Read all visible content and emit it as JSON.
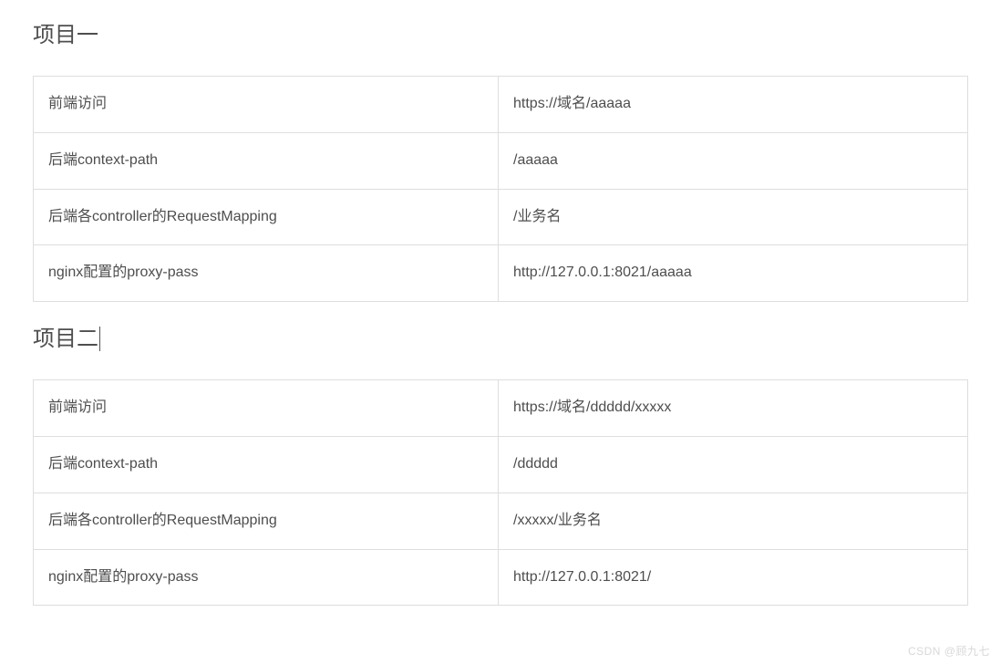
{
  "section1": {
    "title": "项目一",
    "rows": [
      {
        "label": "前端访问",
        "value": "https://域名/aaaaa"
      },
      {
        "label": "后端context-path",
        "value": "/aaaaa"
      },
      {
        "label": "后端各controller的RequestMapping",
        "value": "/业务名"
      },
      {
        "label": "nginx配置的proxy-pass",
        "value": "http://127.0.0.1:8021/aaaaa"
      }
    ]
  },
  "section2": {
    "title": "项目二",
    "rows": [
      {
        "label": "前端访问",
        "value": "https://域名/ddddd/xxxxx"
      },
      {
        "label": "后端context-path",
        "value": "/ddddd"
      },
      {
        "label": "后端各controller的RequestMapping",
        "value": "/xxxxx/业务名"
      },
      {
        "label": "nginx配置的proxy-pass",
        "value": "http://127.0.0.1:8021/"
      }
    ]
  },
  "watermark": "CSDN @顾九七"
}
